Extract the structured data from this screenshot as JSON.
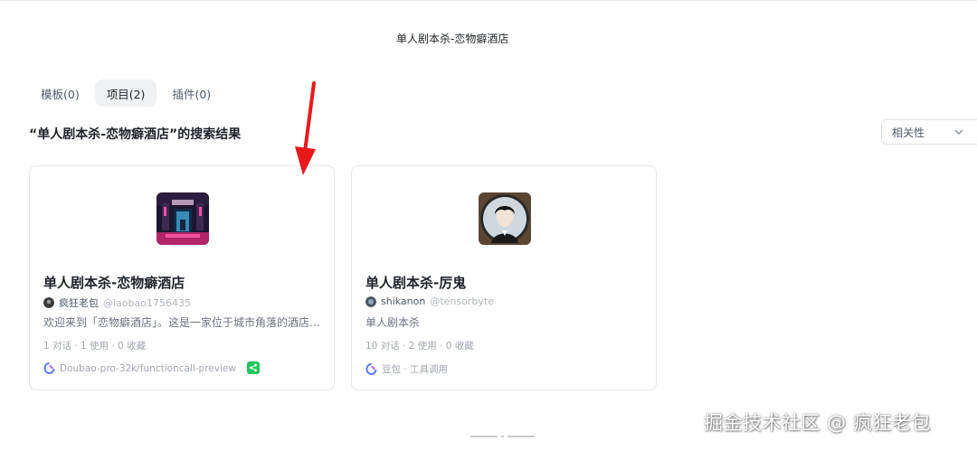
{
  "search": {
    "value": "单人剧本杀-恋物癖酒店"
  },
  "tabs": [
    {
      "label": "模板(0)",
      "active": false
    },
    {
      "label": "项目(2)",
      "active": true
    },
    {
      "label": "插件(0)",
      "active": false
    }
  ],
  "results": {
    "title": "“单人剧本杀-恋物癖酒店”的搜索结果"
  },
  "sort": {
    "selected": "相关性"
  },
  "cards": [
    {
      "name": "单人剧本杀-恋物癖酒店",
      "author": "疯狂老包",
      "handle": "@laobao1756435",
      "description": "欢迎来到「恋物癖酒店」。这是一家位于城市角落的酒店…",
      "stats": "1 对话 · 1 使用 · 0 收藏",
      "model": "Doubao-pro-32k/functioncall-preview",
      "icons": [
        "hotel-avatar",
        "doubao-logo-icon",
        "share-icon"
      ]
    },
    {
      "name": "单人剧本杀-厉鬼",
      "author": "shikanon",
      "handle": "@tensorbyte",
      "description": "单人剧本杀",
      "stats": "10 对话 · 2 使用 · 0 收藏",
      "model": "豆包 · 工具调用",
      "icons": [
        "ghost-avatar",
        "doubao-logo-icon"
      ]
    }
  ],
  "watermark": "掘金技术社区 @ 疯狂老包",
  "colors": {
    "accent_green": "#22c55e",
    "annotation_arrow": "#e8191b"
  }
}
